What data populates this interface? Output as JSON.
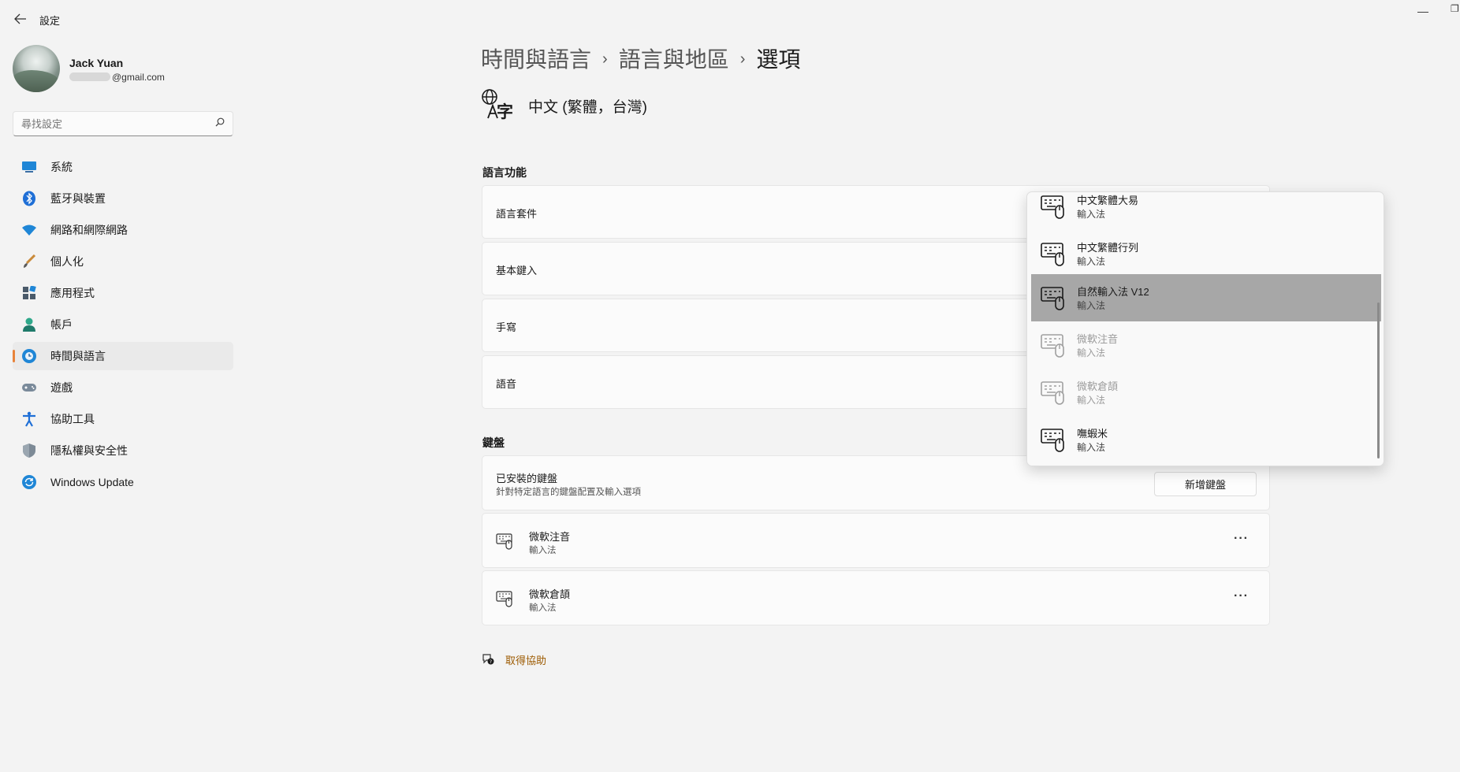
{
  "window": {
    "app_title": "設定",
    "back_icon": "back-arrow-icon",
    "minimize_glyph": "—",
    "restore_glyph": "❐"
  },
  "profile": {
    "name": "Jack Yuan",
    "email_suffix": "@gmail.com"
  },
  "search": {
    "placeholder": "尋找設定",
    "icon_glyph": "⌕"
  },
  "nav": {
    "items": [
      {
        "label": "系統",
        "icon": "system-display-icon",
        "active": false
      },
      {
        "label": "藍牙與裝置",
        "icon": "bluetooth-icon",
        "active": false
      },
      {
        "label": "網路和網際網路",
        "icon": "wifi-icon",
        "active": false
      },
      {
        "label": "個人化",
        "icon": "paintbrush-icon",
        "active": false
      },
      {
        "label": "應用程式",
        "icon": "apps-icon",
        "active": false
      },
      {
        "label": "帳戶",
        "icon": "account-icon",
        "active": false
      },
      {
        "label": "時間與語言",
        "icon": "globe-clock-icon",
        "active": true
      },
      {
        "label": "遊戲",
        "icon": "gamepad-icon",
        "active": false
      },
      {
        "label": "協助工具",
        "icon": "accessibility-icon",
        "active": false
      },
      {
        "label": "隱私權與安全性",
        "icon": "shield-icon",
        "active": false
      },
      {
        "label": "Windows Update",
        "icon": "windows-update-icon",
        "active": false
      }
    ]
  },
  "breadcrumb": {
    "items": [
      "時間與語言",
      "語言與地區",
      "選項"
    ],
    "separator": "›"
  },
  "language": {
    "title": "中文 (繁體，台灣)",
    "icon_glyph": "字"
  },
  "language_features": {
    "section_title": "語言功能",
    "rows": [
      "語言套件",
      "基本鍵入",
      "手寫",
      "語音"
    ]
  },
  "keyboards": {
    "section_title": "鍵盤",
    "installed_title": "已安裝的鍵盤",
    "installed_subtitle": "針對特定語言的鍵盤配置及輸入選項",
    "add_button": "新增鍵盤",
    "items": [
      {
        "name": "微軟注音",
        "type": "輸入法"
      },
      {
        "name": "微軟倉頡",
        "type": "輸入法"
      }
    ],
    "more_glyph": "···"
  },
  "flyout": {
    "items": [
      {
        "name": "中文繁體大易",
        "type": "輸入法",
        "state": "normal"
      },
      {
        "name": "中文繁體行列",
        "type": "輸入法",
        "state": "normal"
      },
      {
        "name": "自然輸入法 V12",
        "type": "輸入法",
        "state": "selected"
      },
      {
        "name": "微軟注音",
        "type": "輸入法",
        "state": "disabled"
      },
      {
        "name": "微軟倉頡",
        "type": "輸入法",
        "state": "disabled"
      },
      {
        "name": "嘸蝦米",
        "type": "輸入法",
        "state": "normal"
      }
    ]
  },
  "help": {
    "label": "取得協助"
  },
  "colors": {
    "accent": "#e8833a",
    "link": "#9c5a00",
    "selected_item": "#a7a7a7"
  }
}
